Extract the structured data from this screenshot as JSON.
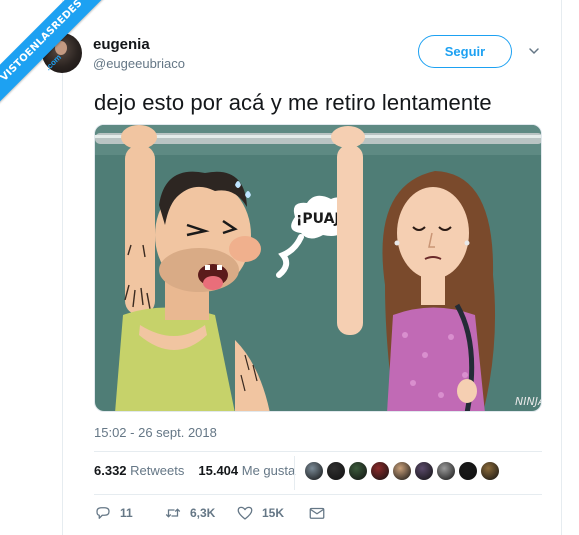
{
  "watermark": {
    "main": "VISTOENLASREDES",
    "sub": ".com"
  },
  "user": {
    "name": "eugenia",
    "handle": "@eugeeubriaco"
  },
  "follow_label": "Seguir",
  "tweet": {
    "text": "dejo esto por acá y me retiro lentamente",
    "image_signature": "NINJA",
    "speech_text": "¡PUAJ!",
    "timestamp": "15:02 - 26 sept. 2018"
  },
  "stats": {
    "retweets_count": "6.332",
    "retweets_label": "Retweets",
    "likes_count": "15.404",
    "likes_label": "Me gusta"
  },
  "likers": [
    "#7a8a96",
    "#2f2f2f",
    "#3b5a3b",
    "#8a2a2a",
    "#c9a07a",
    "#5a4a6a",
    "#9a9a9a",
    "#1a1a1a",
    "#8a6a3a"
  ],
  "actions": {
    "reply_count": "11",
    "retweet_count": "6,3K",
    "like_count": "15K"
  },
  "colors": {
    "accent": "#1da1f2",
    "text": "#14171a",
    "muted": "#657786"
  },
  "icons": [
    "reply-icon",
    "retweet-icon",
    "like-icon",
    "message-icon",
    "chevron-down-icon"
  ]
}
